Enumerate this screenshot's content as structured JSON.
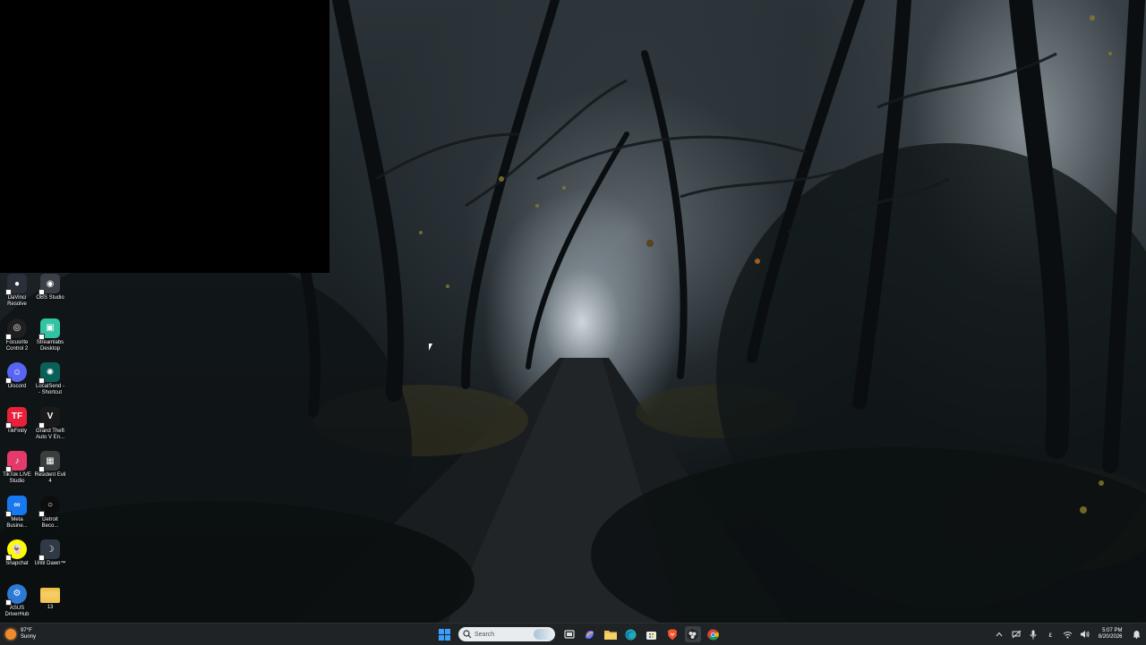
{
  "desktop": {
    "icons": [
      {
        "label": "DaVinci\nResolve",
        "name": "davinci-resolve-icon",
        "color": "#2a2f3a",
        "glyph": "●"
      },
      {
        "label": "OBS Studio",
        "name": "obs-studio-icon",
        "color": "#3b3f47",
        "glyph": "◉"
      },
      {
        "label": "Focusrite\nControl 2",
        "name": "focusrite-control-icon",
        "color": "#1f1f1f",
        "glyph": "◎"
      },
      {
        "label": "Streamlabs\nDesktop",
        "name": "streamlabs-icon",
        "color": "#31c3a2",
        "glyph": "▣"
      },
      {
        "label": "Discord",
        "name": "discord-icon",
        "color": "#5865f2",
        "glyph": "☺"
      },
      {
        "label": "LocalSend -\n- Shortcut",
        "name": "localsend-icon",
        "color": "#0b5f59",
        "glyph": "✺"
      },
      {
        "label": "TikFinity",
        "name": "tikfinity-icon",
        "color": "#e8213a",
        "glyph": "TF"
      },
      {
        "label": "Grand Theft\nAuto V En...",
        "name": "gta-v-icon",
        "color": "#1a1a1a",
        "glyph": "V"
      },
      {
        "label": "TikTok LIVE\nStudio",
        "name": "tiktok-live-studio-icon",
        "color": "#e33a6b",
        "glyph": "♪"
      },
      {
        "label": "Resident Evil\n4",
        "name": "resident-evil-4-icon",
        "color": "#3a3f3d",
        "glyph": "▦"
      },
      {
        "label": "Meta\nBusine...",
        "name": "meta-business-icon",
        "color": "#1778f2",
        "glyph": "∞"
      },
      {
        "label": "Detroit\nBeco...",
        "name": "detroit-icon",
        "color": "#0d0d0d",
        "glyph": "○"
      },
      {
        "label": "Snapchat",
        "name": "snapchat-icon",
        "color": "#fffc00",
        "glyph": "👻"
      },
      {
        "label": "Until Dawn™",
        "name": "until-dawn-icon",
        "color": "#2f3a46",
        "glyph": "☽"
      },
      {
        "label": "ASUS\nDriverHub",
        "name": "asus-driverhub-icon",
        "color": "#2c7ad6",
        "glyph": "⚙"
      },
      {
        "label": "13",
        "name": "folder-icon",
        "color": "#f2c14e",
        "glyph": ""
      }
    ]
  },
  "taskbar": {
    "weather": {
      "temp": "97°F",
      "condition": "Sunny"
    },
    "search_placeholder": "Search",
    "pinned": [
      {
        "name": "task-view-icon"
      },
      {
        "name": "copilot-icon"
      },
      {
        "name": "file-explorer-icon"
      },
      {
        "name": "edge-icon"
      },
      {
        "name": "microsoft-store-icon"
      },
      {
        "name": "brave-icon"
      },
      {
        "name": "obs-taskbar-icon"
      },
      {
        "name": "chrome-icon"
      }
    ],
    "tray": {
      "keyboard_layout": "ε",
      "time": "5:07 PM",
      "date": "8/20/2026"
    }
  }
}
